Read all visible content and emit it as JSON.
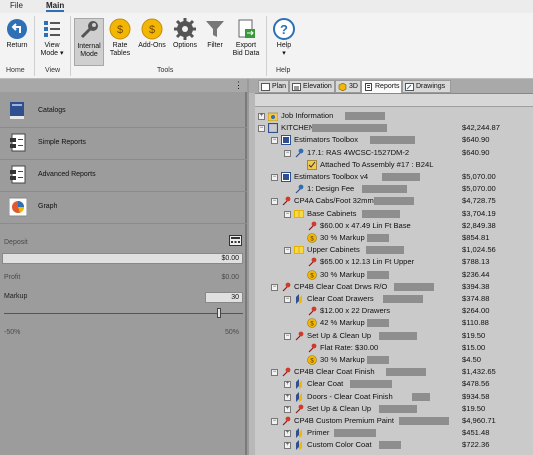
{
  "menu": {
    "file": "File",
    "main": "Main"
  },
  "ribbon": {
    "buttons": {
      "return": "Return",
      "view_mode": "View Mode",
      "internal_mode": "Internal Mode",
      "rate_tables": "Rate Tables",
      "add_ons": "Add-Ons",
      "options": "Options",
      "filter": "Filter",
      "export_bid_data": "Export Bid Data",
      "help": "Help"
    },
    "groups": {
      "home": "Home",
      "view": "View",
      "tools": "Tools",
      "help": "Help"
    },
    "colors": {
      "accent_blue": "#2f6fb5",
      "accent_yellow": "#f2b705"
    }
  },
  "left": {
    "menu_glyph": "⋮",
    "nav": [
      {
        "label": "Catalogs",
        "icon": "catalog-icon"
      },
      {
        "label": "Simple Reports",
        "icon": "report-icon"
      },
      {
        "label": "Advanced Reports",
        "icon": "report-icon"
      },
      {
        "label": "Graph",
        "icon": "pie-chart-icon"
      }
    ],
    "deposit_label": "Deposit",
    "deposit_value": "$0.00",
    "profit_label": "Profit",
    "profit_value": "$0.00",
    "markup_label": "Markup",
    "markup_value": "30",
    "slider_min": "-50%",
    "slider_max": "50%",
    "slider_position": 0.9
  },
  "tabs": [
    {
      "label": "Plan"
    },
    {
      "label": "Elevation"
    },
    {
      "label": "3D"
    },
    {
      "label": "Reports"
    },
    {
      "label": "Drawings"
    }
  ],
  "tree": [
    {
      "text": "Job Information",
      "amount": "",
      "icon": "folder-info-icon",
      "exp": "+"
    },
    {
      "text": "KITCHEN",
      "amount": "$42,244.87",
      "icon": "room-icon",
      "exp": "−"
    },
    {
      "text": "Estimators Toolbox",
      "amount": "$640.90",
      "icon": "toolbox-icon",
      "exp": "−"
    },
    {
      "text": "17.1: RAS 4WCSC-1527DM-2",
      "amount": "$640.90",
      "icon": "pin-blue-icon",
      "exp": "−"
    },
    {
      "text": "Attached To Assembly #17 : B24L",
      "amount": "",
      "icon": "attach-icon",
      "exp": ""
    },
    {
      "text": "Estimators Toolbox v4",
      "amount": "$5,070.00",
      "icon": "toolbox-icon",
      "exp": "−"
    },
    {
      "text": "1: Design Fee",
      "amount": "$5,070.00",
      "icon": "pin-blue-icon",
      "exp": ""
    },
    {
      "text": "CP4A Cabs/Foot 32mm",
      "amount": "$4,728.75",
      "icon": "pin-red-icon",
      "exp": "−"
    },
    {
      "text": "Base Cabinets",
      "amount": "$3,704.19",
      "icon": "cabinet-icon",
      "exp": "−"
    },
    {
      "text": "$60.00 x 47.49 Lin Ft Base",
      "amount": "$2,849.38",
      "icon": "pin-red-icon",
      "exp": ""
    },
    {
      "text": "30 % Markup",
      "amount": "$854.81",
      "icon": "markup-icon",
      "exp": ""
    },
    {
      "text": "Upper Cabinets",
      "amount": "$1,024.56",
      "icon": "cabinet-icon",
      "exp": "−"
    },
    {
      "text": "$65.00 x 12.13 Lin Ft Upper",
      "amount": "$788.13",
      "icon": "pin-red-icon",
      "exp": ""
    },
    {
      "text": "30 % Markup",
      "amount": "$236.44",
      "icon": "markup-icon",
      "exp": ""
    },
    {
      "text": "CP4B Clear Coat Drws R/O",
      "amount": "$394.38",
      "icon": "pin-red-icon",
      "exp": "−"
    },
    {
      "text": "Clear Coat Drawers",
      "amount": "$374.88",
      "icon": "brush-icon",
      "exp": "−"
    },
    {
      "text": "$12.00 x 22 Drawers",
      "amount": "$264.00",
      "icon": "pin-red-icon",
      "exp": ""
    },
    {
      "text": "42 % Markup",
      "amount": "$110.88",
      "icon": "markup-icon",
      "exp": ""
    },
    {
      "text": "Set Up & Clean Up",
      "amount": "$19.50",
      "icon": "pin-red-icon",
      "exp": "−"
    },
    {
      "text": "Flat Rate: $30.00",
      "amount": "$15.00",
      "icon": "pin-red-icon",
      "exp": ""
    },
    {
      "text": "30 % Markup",
      "amount": "$4.50",
      "icon": "markup-icon",
      "exp": ""
    },
    {
      "text": "CP4B Clear Coat Finish",
      "amount": "$1,432.65",
      "icon": "pin-red-icon",
      "exp": "−"
    },
    {
      "text": "Clear Coat",
      "amount": "$478.56",
      "icon": "brush-icon",
      "exp": "+"
    },
    {
      "text": "Doors - Clear Coat Finish",
      "amount": "$934.58",
      "icon": "brush-icon",
      "exp": "+"
    },
    {
      "text": "Set Up & Clean Up",
      "amount": "$19.50",
      "icon": "pin-red-icon",
      "exp": "+"
    },
    {
      "text": "CP4B Custom Premium Paint",
      "amount": "$4,960.71",
      "icon": "pin-red-icon",
      "exp": "−"
    },
    {
      "text": "Primer",
      "amount": "$451.48",
      "icon": "brush-icon",
      "exp": "+"
    },
    {
      "text": "Custom Color Coat",
      "amount": "$722.36",
      "icon": "brush-icon",
      "exp": "+"
    }
  ]
}
